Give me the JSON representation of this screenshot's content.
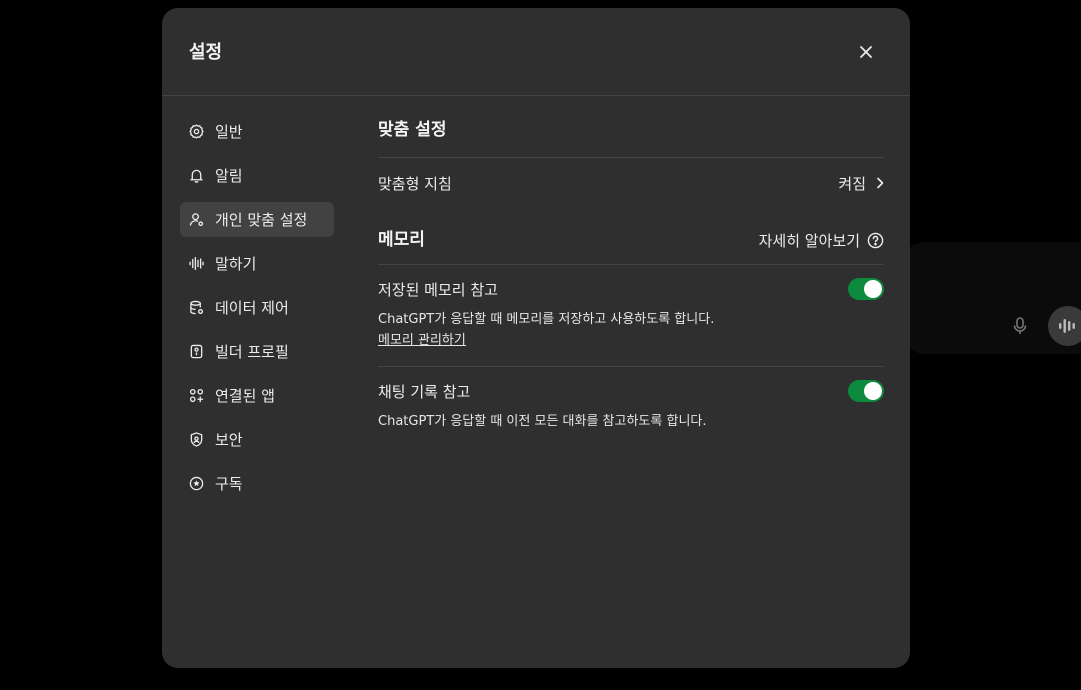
{
  "modal": {
    "title": "설정"
  },
  "sidebar": {
    "items": [
      {
        "label": "일반",
        "icon": "gear-icon"
      },
      {
        "label": "알림",
        "icon": "bell-icon"
      },
      {
        "label": "개인 맞춤 설정",
        "icon": "user-settings-icon",
        "active": true
      },
      {
        "label": "말하기",
        "icon": "waveform-icon"
      },
      {
        "label": "데이터 제어",
        "icon": "database-gear-icon"
      },
      {
        "label": "빌더 프로필",
        "icon": "id-card-icon"
      },
      {
        "label": "연결된 앱",
        "icon": "apps-grid-icon"
      },
      {
        "label": "보안",
        "icon": "shield-icon"
      },
      {
        "label": "구독",
        "icon": "badge-icon"
      }
    ]
  },
  "personalization": {
    "title": "맞춤 설정",
    "custom_instructions_label": "맞춤형 지침",
    "custom_instructions_status": "켜짐"
  },
  "memory": {
    "title": "메모리",
    "learn_more": "자세히 알아보기",
    "saved_memory_label": "저장된 메모리 참고",
    "saved_memory_enabled": true,
    "saved_memory_desc": "ChatGPT가 응답할 때 메모리를 저장하고 사용하도록 합니다.",
    "manage_link": "메모리 관리하기",
    "chat_history_label": "채팅 기록 참고",
    "chat_history_enabled": true,
    "chat_history_desc": "ChatGPT가 응답할 때 이전 모든 대화를 참고하도록 합니다."
  },
  "colors": {
    "toggle_on": "#0e8a3e",
    "modal_bg": "#2f2f2f",
    "active_item_bg": "#424242"
  }
}
